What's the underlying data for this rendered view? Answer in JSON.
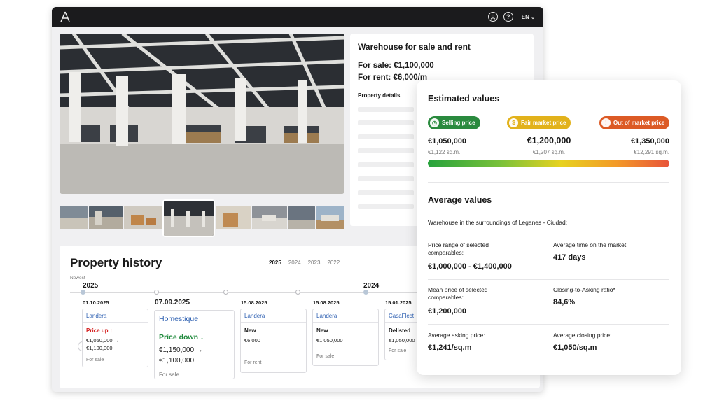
{
  "app": {
    "lang": "EN",
    "icons": {
      "logo": "a-logo",
      "user": "user-icon",
      "help": "help-icon",
      "lang_chevron": "chevron-down-icon"
    }
  },
  "listing": {
    "title": "Warehouse for sale and rent",
    "sale_price": "For sale:  €1,100,000",
    "rent_price": "For rent: €6,000/m",
    "details_title": "Property details"
  },
  "history": {
    "title": "Property history",
    "years_nav": [
      "2025",
      "2024",
      "2023",
      "2022"
    ],
    "newest_label": "Newest",
    "timeline_years": [
      "2025",
      "2024"
    ],
    "events": [
      {
        "date": "01.10.2025",
        "portal": "Landera",
        "change": "Price up ↑",
        "values": [
          "€1,050,000 →",
          "€1,100,000"
        ],
        "type": "For sale"
      },
      {
        "date": "07.09.2025",
        "portal": "Homestique",
        "change": "Price down ↓",
        "values": [
          "€1,150,000 →",
          "€1,100,000"
        ],
        "type": "For sale"
      },
      {
        "date": "15.08.2025",
        "portal": "Landera",
        "change": "New",
        "values": [
          "€6,000"
        ],
        "type": "For rent"
      },
      {
        "date": "15.08.2025",
        "portal": "Landera",
        "change": "New",
        "values": [
          "€1,050,000"
        ],
        "type": "For sale"
      },
      {
        "date": "15.01.2025",
        "portal": "CasaFlect",
        "change": "Delisted",
        "values": [
          "€1,050,000"
        ],
        "type": "For sale"
      }
    ],
    "prev_arrow": "‹"
  },
  "estimated": {
    "title": "Estimated values",
    "badges": [
      {
        "label": "Selling price",
        "color": "#2a8a3e",
        "icon": "clock-icon",
        "glyph": "◷"
      },
      {
        "label": "Fair market price",
        "color": "#e2b21b",
        "icon": "coin-icon",
        "glyph": "$"
      },
      {
        "label": "Out of market price",
        "color": "#dc5a25",
        "icon": "alert-icon",
        "glyph": "!"
      }
    ],
    "values": [
      {
        "price": "€1,050,000",
        "per_sqm": "€1,122 sq.m."
      },
      {
        "price": "€1,200,000",
        "per_sqm": "€1,207 sq.m."
      },
      {
        "price": "€1,350,000",
        "per_sqm": "€12,291 sq.m."
      }
    ]
  },
  "average": {
    "title": "Average values",
    "subtitle": "Warehouse in the surroundings of Leganes - Ciudad:",
    "metrics": [
      {
        "label": "Price range of selected comparables:",
        "value": "€1,000,000 - €1,400,000"
      },
      {
        "label": "Average time on the market:",
        "value": "417 days"
      },
      {
        "label": "Mean price of selected comparables:",
        "value": "€1,200,000"
      },
      {
        "label": "Closing-to-Asking ratio*",
        "value": "84,6%"
      },
      {
        "label": "Average asking price:",
        "value": "€1,241/sq.m"
      },
      {
        "label": "Average closing price:",
        "value": "€1,050/sq.m"
      }
    ]
  }
}
